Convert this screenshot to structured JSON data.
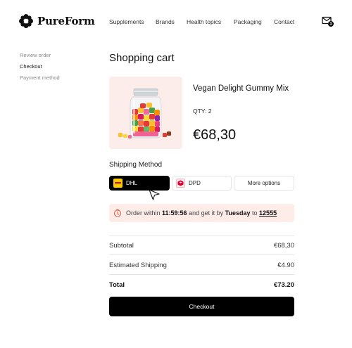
{
  "brand": {
    "name": "PureForm",
    "logo_icon": "flower-logo-icon"
  },
  "nav": [
    "Supplements",
    "Brands",
    "Health topics",
    "Packaging",
    "Contact"
  ],
  "cart": {
    "icon": "cart-icon",
    "badge": "1"
  },
  "sidebar": {
    "items": [
      {
        "label": "Review order",
        "active": false
      },
      {
        "label": "Checkout",
        "active": true
      },
      {
        "label": "Payment method",
        "active": false
      }
    ]
  },
  "page": {
    "title": "Shopping cart"
  },
  "product": {
    "name": "Vegan Delight Gummy Mix",
    "qty": "QTY: 2",
    "price": "€68,30",
    "image_bg": "#fcecea"
  },
  "shipping": {
    "label": "Shipping Method",
    "options": [
      {
        "label": "DHL",
        "selected": true,
        "icon": "dhl-logo-icon"
      },
      {
        "label": "DPD",
        "selected": false,
        "icon": "dpd-logo-icon"
      },
      {
        "label": "More options",
        "selected": false
      }
    ]
  },
  "notice": {
    "prefix": "Order within",
    "time": "11:59:56",
    "middle": "and get it by",
    "day": "Tuesday",
    "to": "to",
    "zip": "12555",
    "icon": "clock-icon",
    "bg_color": "#fdece8"
  },
  "summary": {
    "subtotal_label": "Subtotal",
    "subtotal_value": "€68,30",
    "shipping_label": "Estimated Shipping",
    "shipping_value": "€4.90",
    "total_label": "Total",
    "total_value": "€73.20"
  },
  "checkout": {
    "label": "Checkout"
  }
}
